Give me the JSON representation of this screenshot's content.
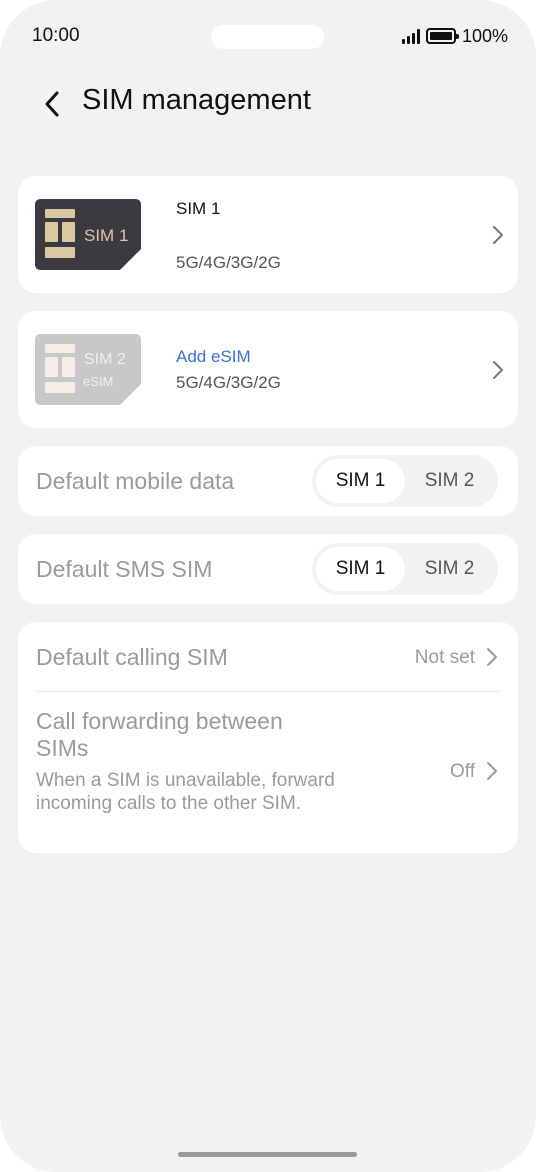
{
  "status": {
    "time": "10:00",
    "battery": "100%"
  },
  "header": {
    "title": "SIM management"
  },
  "sims": [
    {
      "badge": "SIM 1",
      "name": "SIM 1",
      "network": "5G/4G/3G/2G"
    },
    {
      "badge": "SIM 2",
      "badge_sub": "eSIM",
      "action": "Add eSIM",
      "network": "5G/4G/3G/2G"
    }
  ],
  "default_data": {
    "label": "Default mobile data",
    "options": [
      "SIM 1",
      "SIM 2"
    ],
    "selected": "SIM 1"
  },
  "default_sms": {
    "label": "Default SMS SIM",
    "options": [
      "SIM 1",
      "SIM 2"
    ],
    "selected": "SIM 1"
  },
  "calling": {
    "label": "Default calling SIM",
    "value": "Not set"
  },
  "forwarding": {
    "title": "Call forwarding between SIMs",
    "description": "When a SIM is unavailable, forward incoming calls to the other SIM.",
    "value": "Off"
  },
  "colors": {
    "background": "#f1f2f4",
    "card": "#ffffff",
    "accent": "#3a6fd6",
    "disabled_text": "#9a9a9a",
    "sim1_card": "#3a3a40",
    "sim2_card": "#c8c8c8"
  }
}
